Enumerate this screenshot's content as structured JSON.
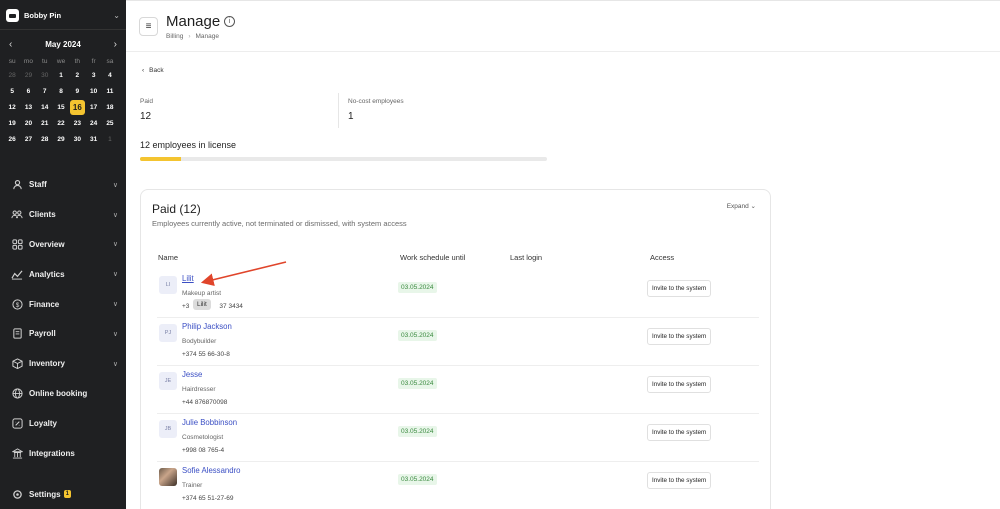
{
  "sidebar": {
    "brand": "Bobby Pin",
    "calendar": {
      "month": "May 2024",
      "weekdays": [
        "su",
        "mo",
        "tu",
        "we",
        "th",
        "fr",
        "sa"
      ],
      "weeks": [
        [
          "28",
          "29",
          "30",
          "1",
          "2",
          "3",
          "4"
        ],
        [
          "5",
          "6",
          "7",
          "8",
          "9",
          "10",
          "11"
        ],
        [
          "12",
          "13",
          "14",
          "15",
          "16",
          "17",
          "18"
        ],
        [
          "19",
          "20",
          "21",
          "22",
          "23",
          "24",
          "25"
        ],
        [
          "26",
          "27",
          "28",
          "29",
          "30",
          "31",
          "1"
        ]
      ],
      "today": "16"
    },
    "nav": [
      {
        "label": "Staff",
        "icon": "person-icon",
        "chevron": true
      },
      {
        "label": "Clients",
        "icon": "people-icon",
        "chevron": true
      },
      {
        "label": "Overview",
        "icon": "grid-icon",
        "chevron": true
      },
      {
        "label": "Analytics",
        "icon": "chart-icon",
        "chevron": true
      },
      {
        "label": "Finance",
        "icon": "dollar-icon",
        "chevron": true
      },
      {
        "label": "Payroll",
        "icon": "payroll-icon",
        "chevron": true
      },
      {
        "label": "Inventory",
        "icon": "box-icon",
        "chevron": true
      },
      {
        "label": "Online booking",
        "icon": "globe-icon",
        "chevron": false
      },
      {
        "label": "Loyalty",
        "icon": "loyalty-icon",
        "chevron": false
      },
      {
        "label": "Integrations",
        "icon": "integrations-icon",
        "chevron": false
      }
    ],
    "settings": {
      "label": "Settings",
      "badge": "1"
    }
  },
  "header": {
    "title": "Manage",
    "breadcrumb": [
      "Billing",
      "Manage"
    ]
  },
  "main": {
    "back_label": "Back",
    "stats": [
      {
        "label": "Paid",
        "value": "12"
      },
      {
        "label": "No-cost employees",
        "value": "1"
      }
    ],
    "license_label": "12 employees in license",
    "license_fill": 0.1,
    "card": {
      "title": "Paid (12)",
      "subtitle": "Employees currently active, not terminated or dismissed, with system access",
      "expand_label": "Expand",
      "columns": [
        "Name",
        "Work schedule until",
        "Last login",
        "Access"
      ],
      "rows": [
        {
          "initials": "LI",
          "name": "Lilit",
          "role": "Makeup artist",
          "phone": "+3",
          "phone_tail": "37 3434",
          "schedule": "03.05.2024",
          "login": "",
          "access": "Invite to the system"
        },
        {
          "initials": "PJ",
          "name": "Philip Jackson",
          "role": "Bodybuilder",
          "phone": "+374 55 66-30-8",
          "phone_tail": "",
          "schedule": "03.05.2024",
          "login": "",
          "access": "Invite to the system"
        },
        {
          "initials": "JE",
          "name": "Jesse",
          "role": "Hairdresser",
          "phone": "+44 876870098",
          "phone_tail": "",
          "schedule": "03.05.2024",
          "login": "",
          "access": "Invite to the system"
        },
        {
          "initials": "JB",
          "name": "Julie Bobbinson",
          "role": "Cosmetologist",
          "phone": "+998 08 765-4",
          "phone_tail": "",
          "schedule": "03.05.2024",
          "login": "",
          "access": "Invite to the system"
        },
        {
          "initials": "",
          "name": "Sofie Alessandro",
          "role": "Trainer",
          "phone": "+374 65 51-27-69",
          "phone_tail": "",
          "schedule": "03.05.2024",
          "login": "",
          "access": "Invite to the system"
        }
      ]
    },
    "tooltip": "Lilit",
    "annotation_color": "#e0452b"
  }
}
